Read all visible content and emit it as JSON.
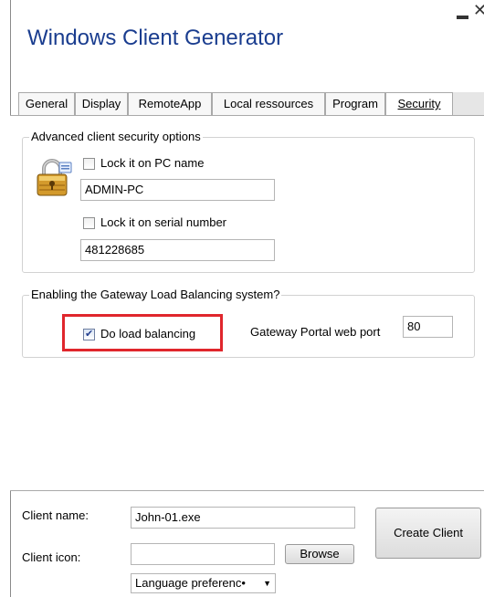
{
  "window": {
    "title": "Windows Client Generator",
    "close_glyph": "✕"
  },
  "tabs": [
    {
      "label": "General",
      "active": false
    },
    {
      "label": "Display",
      "active": false
    },
    {
      "label": "RemoteApp",
      "active": false
    },
    {
      "label": "Local ressources",
      "active": false
    },
    {
      "label": "Program",
      "active": false
    },
    {
      "label": "Security",
      "active": true
    }
  ],
  "security": {
    "group_title": "Advanced client security options",
    "lock_pc_name": {
      "label": "Lock it on PC name",
      "checked": false,
      "value": "ADMIN-PC"
    },
    "lock_serial": {
      "label": "Lock it on serial number",
      "checked": false,
      "value": "481228685"
    }
  },
  "load_balancing": {
    "group_title": "Enabling the Gateway Load Balancing system?",
    "do_load_balancing": {
      "label": "Do load balancing",
      "checked": true
    },
    "port_label": "Gateway Portal web port",
    "port_value": "80"
  },
  "footer": {
    "client_name_label": "Client name:",
    "client_name_value": "John-01.exe",
    "client_icon_label": "Client icon:",
    "client_icon_value": "",
    "browse_label": "Browse",
    "create_label": "Create Client",
    "language_value": "Language preferenc•"
  },
  "colors": {
    "title": "#1a3d8f",
    "highlight_border": "#e0262c"
  }
}
